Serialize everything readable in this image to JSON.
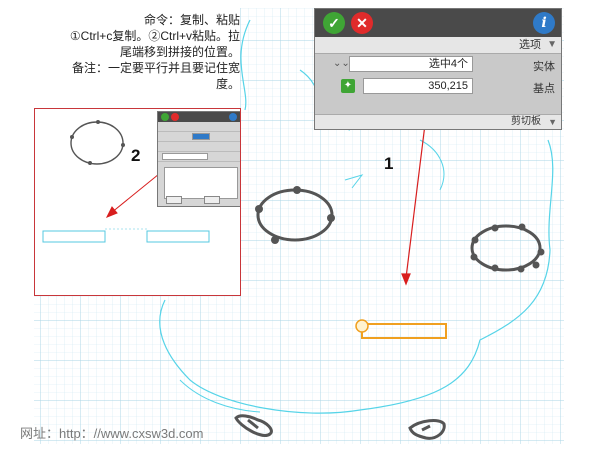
{
  "note": {
    "lines": [
      "命令：复制、粘贴",
      "①Ctrl+c复制。②Ctrl+v粘贴。拉",
      "尾端移到拼接的位置。",
      "备注：一定要平行并且要记住宽",
      "度。"
    ]
  },
  "panel": {
    "section_top": "选项",
    "fields": [
      {
        "label": "实体",
        "value": "选中4个"
      },
      {
        "label": "基点",
        "value": "350,215"
      }
    ],
    "section_bottom": "剪切板"
  },
  "labels": {
    "one": "1",
    "two": "2"
  },
  "watermark": "网址：http：//www.cxsw3d.com",
  "colors": {
    "grid": "#b9dcea",
    "outline": "#56d4e8",
    "arrow": "#d81e1e",
    "highlight": "#f0a020",
    "inset_border": "#c8363a"
  },
  "icons": {
    "ok": "check-icon",
    "cancel": "close-icon",
    "info": "info-icon"
  }
}
